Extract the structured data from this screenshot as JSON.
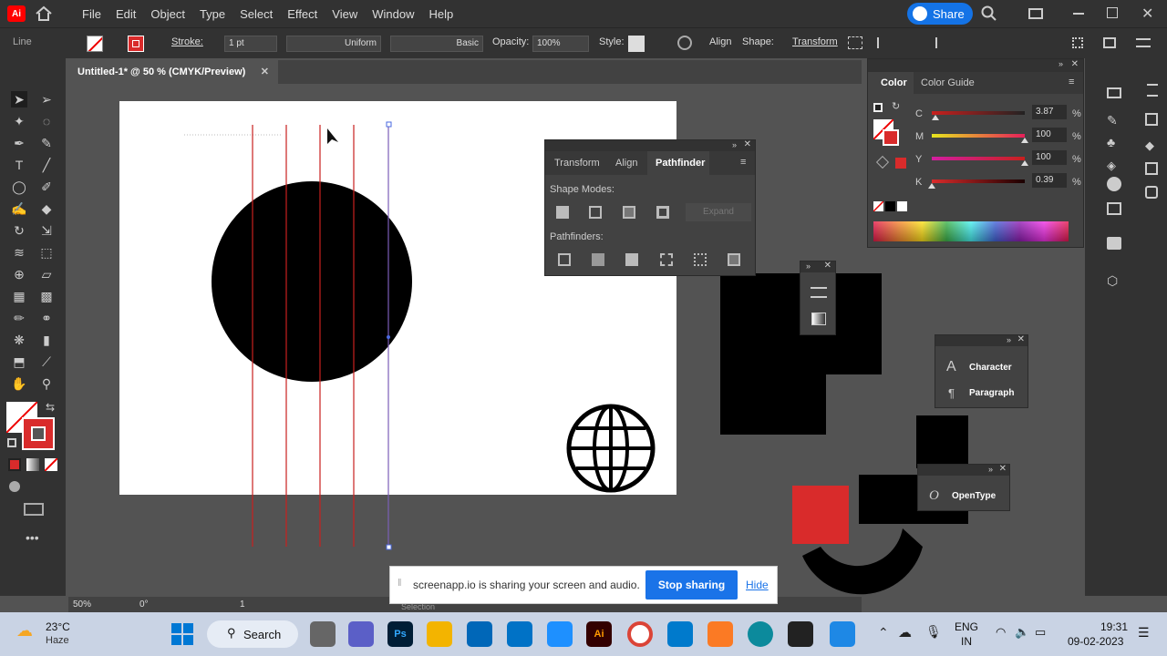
{
  "app": {
    "logo": "Ai",
    "share_label": "Share"
  },
  "menu": [
    "File",
    "Edit",
    "Object",
    "Type",
    "Select",
    "Effect",
    "View",
    "Window",
    "Help"
  ],
  "control": {
    "selection_type": "Line",
    "stroke_label": "Stroke:",
    "stroke_weight": "1 pt",
    "profile": "Uniform",
    "brush": "Basic",
    "opacity_label": "Opacity:",
    "opacity_value": "100%",
    "style_label": "Style:",
    "align": "Align",
    "shape": "Shape:",
    "transform": "Transform"
  },
  "document": {
    "tab_title": "Untitled-1* @ 50 % (CMYK/Preview)"
  },
  "pathfinder": {
    "tabs": [
      "Transform",
      "Align",
      "Pathfinder"
    ],
    "shape_modes": "Shape Modes:",
    "expand": "Expand",
    "pathfinders": "Pathfinders:"
  },
  "color_panel": {
    "tabs": [
      "Color",
      "Color Guide"
    ],
    "channels": [
      {
        "label": "C",
        "value": "3.87",
        "unit": "%",
        "level": 0.04
      },
      {
        "label": "M",
        "value": "100",
        "unit": "%",
        "level": 1.0
      },
      {
        "label": "Y",
        "value": "100",
        "unit": "%",
        "level": 1.0
      },
      {
        "label": "K",
        "value": "0.39",
        "unit": "%",
        "level": 0.0
      }
    ]
  },
  "char_panel": {
    "items": [
      "Character",
      "Paragraph"
    ]
  },
  "opentype_panel": {
    "label": "OpenType"
  },
  "status": {
    "zoom": "50%",
    "rotate": "0°",
    "page": "1",
    "tool": "Selection"
  },
  "screen_share": {
    "message": "screenapp.io is sharing your screen and audio.",
    "stop": "Stop sharing",
    "hide": "Hide"
  },
  "taskbar": {
    "temp": "23°C",
    "weather": "Haze",
    "search": "Search",
    "lang1": "ENG",
    "lang2": "IN",
    "time": "19:31",
    "date": "09-02-2023"
  },
  "colors": {
    "accent": "#1473e6",
    "red": "#d92b2b",
    "panel": "#424242",
    "dark": "#323232"
  }
}
